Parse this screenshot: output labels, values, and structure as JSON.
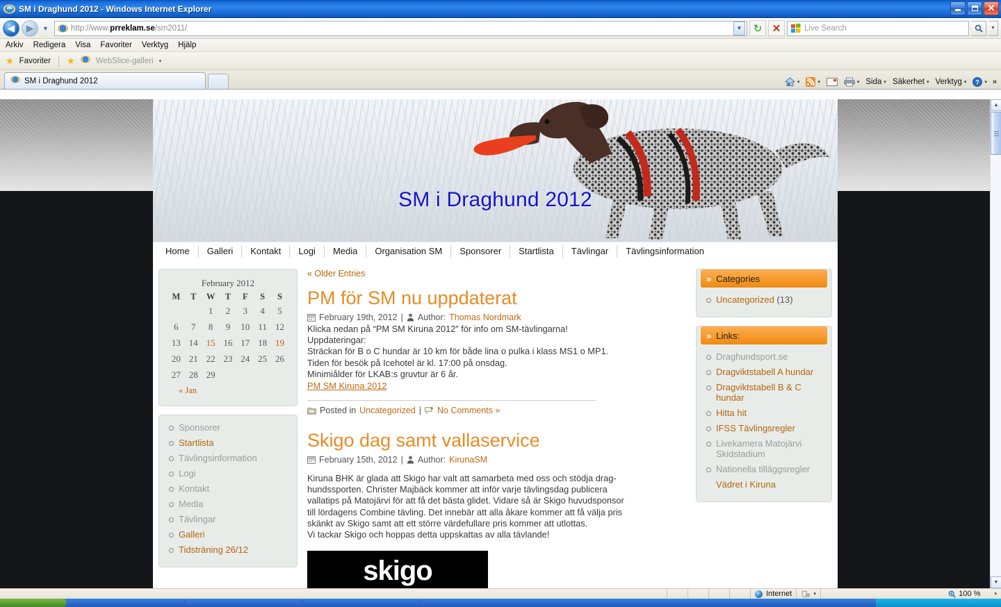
{
  "window": {
    "title": "SM i Draghund 2012 - Windows Internet Explorer",
    "minimize_label": "",
    "maximize_label": "",
    "close_label": "✕"
  },
  "browser": {
    "url_scheme": "http://www.",
    "url_host": "prreklam.se",
    "url_path": "/sm2011/",
    "url_full": "http://www.prreklam.se/sm2011/",
    "back_glyph": "◀",
    "forward_glyph": "▶",
    "history_caret": "▼",
    "url_caret": "▼",
    "refresh_glyph": "↻",
    "stop_glyph": "✕",
    "search_placeholder": "Live Search",
    "search_go_glyph": "🔍",
    "search_caret": "▼",
    "menu": [
      "Arkiv",
      "Redigera",
      "Visa",
      "Favoriter",
      "Verktyg",
      "Hjälp"
    ],
    "favorites_label": "Favoriter",
    "webslice_label": "WebSlice-galleri",
    "webslice_caret": "▾",
    "tab_label": "SM i Draghund 2012",
    "command_bar": [
      {
        "name": "home-button",
        "label": "",
        "icon": "home-icon",
        "caret": "▾"
      },
      {
        "name": "feeds-button",
        "label": "",
        "icon": "rss-icon",
        "caret": "▾"
      },
      {
        "name": "mail-button",
        "label": "",
        "icon": "mail-icon",
        "caret": ""
      },
      {
        "name": "print-button",
        "label": "",
        "icon": "printer-icon",
        "caret": "▾"
      },
      {
        "name": "page-menu",
        "label": "Sida",
        "icon": "",
        "caret": "▾"
      },
      {
        "name": "safety-menu",
        "label": "Säkerhet",
        "icon": "",
        "caret": "▾"
      },
      {
        "name": "tools-menu",
        "label": "Verktyg",
        "icon": "",
        "caret": "▾"
      },
      {
        "name": "help-menu",
        "label": "",
        "icon": "help-icon",
        "caret": "▾"
      }
    ],
    "overflow_glyph": "»"
  },
  "statusbar": {
    "zone_label": "Internet",
    "protected_caret": "▾",
    "zoom_label": "100 %",
    "zoom_caret": "▾"
  },
  "site": {
    "header_title": "SM i Draghund 2012",
    "nav": [
      "Home",
      "Galleri",
      "Kontakt",
      "Logi",
      "Media",
      "Organisation SM",
      "Sponsorer",
      "Startlista",
      "Tävlingar",
      "Tävlingsinformation"
    ]
  },
  "calendar": {
    "caption": "February 2012",
    "weekdays": [
      "M",
      "T",
      "W",
      "T",
      "F",
      "S",
      "S"
    ],
    "weeks": [
      [
        "",
        "",
        "1",
        "2",
        "3",
        "4",
        "5"
      ],
      [
        "6",
        "7",
        "8",
        "9",
        "10",
        "11",
        "12"
      ],
      [
        "13",
        "14",
        "15",
        "16",
        "17",
        "18",
        "19"
      ],
      [
        "20",
        "21",
        "22",
        "23",
        "24",
        "25",
        "26"
      ],
      [
        "27",
        "28",
        "29",
        "",
        "",
        "",
        ""
      ]
    ],
    "highlighted_days": [
      "15",
      "19"
    ],
    "prev_label": "« Jan"
  },
  "left_menu": {
    "items": [
      {
        "label": "Sponsorer",
        "visited": true
      },
      {
        "label": "Startlista",
        "visited": false
      },
      {
        "label": "Tävlingsinformation",
        "visited": true
      },
      {
        "label": "Logi",
        "visited": true
      },
      {
        "label": "Kontakt",
        "visited": true
      },
      {
        "label": "Media",
        "visited": true
      },
      {
        "label": "Tävlingar",
        "visited": true
      },
      {
        "label": "Galleri",
        "visited": false
      },
      {
        "label": "Tidsträning 26/12",
        "visited": false
      }
    ]
  },
  "main": {
    "older_entries": "« Older Entries",
    "posts": [
      {
        "title": "PM för SM nu uppdaterat",
        "date": "February 19th, 2012",
        "author_prefix": "Author:",
        "author": "Thomas Nordmark",
        "body": "Klicka nedan på “PM SM Kiruna 2012” för info om SM-tävlingarna!\nUppdateringar:\nSträckan för B o C hundar är 10 km för både lina o pulka i klass MS1 o MP1.\nTiden för besök på Icehotel är kl. 17:00 på onsdag.\nMinimiålder för LKAB:s gruvtur är 6 år.",
        "attachment": "PM SM Kiruna 2012",
        "posted_in_prefix": "Posted in",
        "category": "Uncategorized",
        "comments": "No Comments »"
      },
      {
        "title": "Skigo dag samt vallaservice",
        "date": "February 15th, 2012",
        "author_prefix": "Author:",
        "author": "KirunaSM",
        "body": "Kiruna BHK är glada att Skigo har valt att samarbeta med oss och stödja drag-\nhundssporten. Christer Majbäck kommer att inför varje tävlingsdag publicera\nvallatips på Matojärvi för att få det bästa glidet. Vidare så är Skigo huvudsponsor\ntill lördagens Combine tävling. Det innebär att alla åkare kommer att få välja pris\nskänkt av Skigo samt att ett större värdefullare pris kommer att utlottas.\nVi tackar Skigo och hoppas detta uppskattas av alla tävlande!",
        "image_text": "skigo"
      }
    ]
  },
  "categories": {
    "heading": "Categories",
    "chevron": "»",
    "items": [
      {
        "label": "Uncategorized",
        "count": "(13)",
        "visited": false
      }
    ]
  },
  "links": {
    "heading": "Links:",
    "chevron": "»",
    "items": [
      {
        "label": "Draghundsport.se",
        "visited": true,
        "bullet": true
      },
      {
        "label": "Dragviktstabell A hundar",
        "visited": false,
        "bullet": true
      },
      {
        "label": "Dragviktstabell B & C hundar",
        "visited": false,
        "bullet": true
      },
      {
        "label": "Hitta hit",
        "visited": false,
        "bullet": true
      },
      {
        "label": "IFSS Tävlingsregler",
        "visited": false,
        "bullet": true
      },
      {
        "label": "Livekamera Matojärvi Skidstadium",
        "visited": true,
        "bullet": true
      },
      {
        "label": "Nationella tilläggsregler",
        "visited": true,
        "bullet": true
      },
      {
        "label": "Vädret i Kiruna",
        "visited": false,
        "bullet": false
      }
    ]
  },
  "colors": {
    "accent_orange": "#f08a10",
    "link_orange": "#b5650f",
    "title_orange": "#e98b25",
    "header_blue": "#1313cf",
    "widget_bg": "#e8ece8"
  }
}
